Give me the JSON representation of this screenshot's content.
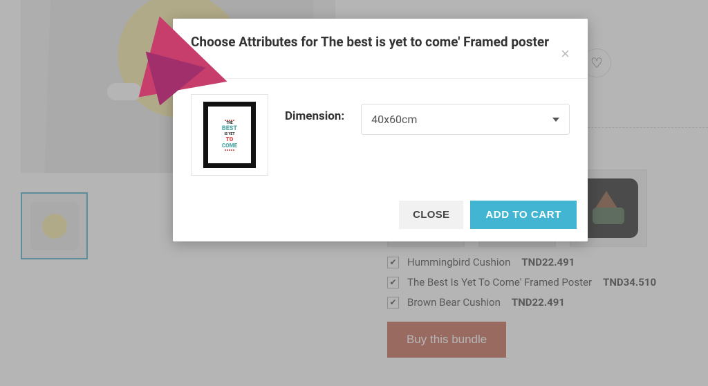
{
  "modal": {
    "title": "Choose Attributes for The best is yet to come' Framed poster",
    "attribute_label": "Dimension:",
    "selected_option": "40x60cm",
    "close_label": "CLOSE",
    "add_label": "ADD TO CART",
    "thumb_lines": {
      "l1": "THE",
      "l2": "BEST",
      "l3": "IS YET",
      "l4": "TO",
      "l5": "COME"
    }
  },
  "bundle": {
    "items": [
      {
        "name": "Hummingbird Cushion",
        "price": "TND22.491",
        "checked": true
      },
      {
        "name": "The Best Is Yet To Come' Framed Poster",
        "price": "TND34.510",
        "checked": true
      },
      {
        "name": "Brown Bear Cushion",
        "price": "TND22.491",
        "checked": true
      }
    ],
    "buy_label": "Buy this bundle"
  },
  "icons": {
    "heart": "♡",
    "check": "✔"
  }
}
